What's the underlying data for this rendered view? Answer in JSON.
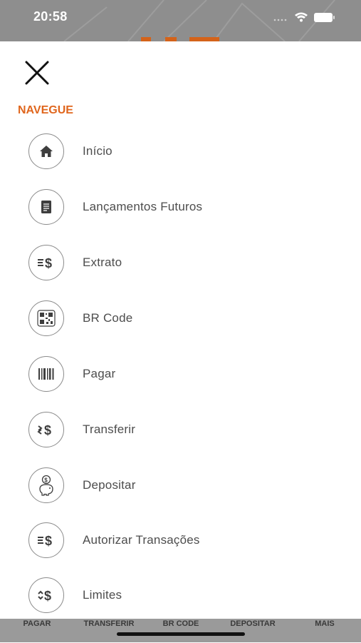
{
  "status_bar": {
    "time": "20:58"
  },
  "drawer": {
    "close_icon": "close-icon",
    "section_title": "NAVEGUE",
    "items": [
      {
        "label": "Início",
        "icon": "home-icon"
      },
      {
        "label": "Lançamentos Futuros",
        "icon": "document-icon"
      },
      {
        "label": "Extrato",
        "icon": "statement-icon"
      },
      {
        "label": "BR Code",
        "icon": "qr-code-icon"
      },
      {
        "label": "Pagar",
        "icon": "barcode-icon"
      },
      {
        "label": "Transferir",
        "icon": "transfer-icon"
      },
      {
        "label": "Depositar",
        "icon": "piggy-bank-icon"
      },
      {
        "label": "Autorizar Transações",
        "icon": "statement-icon"
      },
      {
        "label": "Limites",
        "icon": "limits-icon"
      }
    ]
  },
  "tabbar": {
    "items": [
      {
        "label": "PAGAR"
      },
      {
        "label": "TRANSFERIR"
      },
      {
        "label": "BR CODE"
      },
      {
        "label": "DEPOSITAR"
      },
      {
        "label": "MAIS"
      }
    ]
  },
  "colors": {
    "accent": "#e0661d",
    "icon_border": "#8b8b8b",
    "text": "#4d4d4d"
  }
}
